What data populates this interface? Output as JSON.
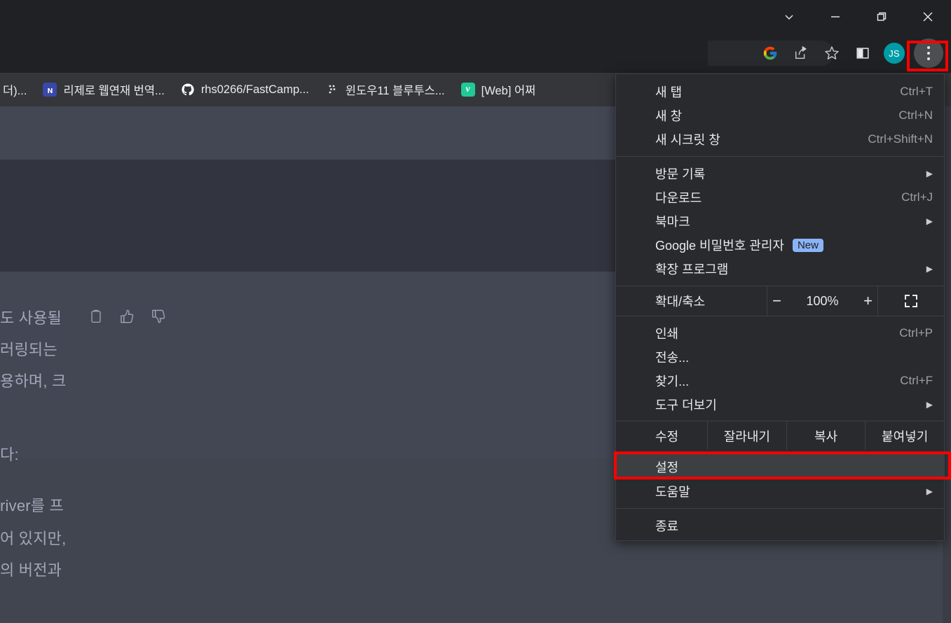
{
  "window": {
    "controls": [
      {
        "name": "chevron-down",
        "glyph": "chevron-down-icon"
      },
      {
        "name": "minimize",
        "glyph": "minimize-icon"
      },
      {
        "name": "restore",
        "glyph": "restore-icon"
      },
      {
        "name": "close",
        "glyph": "close-icon"
      }
    ]
  },
  "toolbar": {
    "icons": [
      {
        "name": "google-lens-icon",
        "label": "Google"
      },
      {
        "name": "share-icon",
        "label": "공유"
      },
      {
        "name": "bookmark-star-icon",
        "label": "북마크 추가"
      },
      {
        "name": "side-panel-icon",
        "label": "측면 패널"
      }
    ],
    "avatar_initials": "JS",
    "avatar_color": "#009ca6",
    "menu_button_label": "Chrome 맞춤설정 및 제어",
    "highlight_color": "#ff0000"
  },
  "bookmarks": [
    {
      "label": "더)...",
      "favicon": "none"
    },
    {
      "label": "리제로 웹연재 번역...",
      "favicon": "naver-blog-icon"
    },
    {
      "label": "rhs0266/FastCamp...",
      "favicon": "github-icon"
    },
    {
      "label": "윈도우11 블루투스...",
      "favicon": "braille-dots-icon"
    },
    {
      "label": "[Web] 어쩌",
      "favicon": "velog-icon"
    }
  ],
  "page": {
    "lines": [
      "도 사용될",
      "러링되는",
      "용하며, 크",
      "다:",
      "river를 프",
      "어 있지만,",
      "의 버전과"
    ],
    "action_icons": [
      {
        "name": "copy-icon"
      },
      {
        "name": "thumbs-up-icon"
      },
      {
        "name": "thumbs-down-icon"
      }
    ]
  },
  "menu": {
    "groups": [
      {
        "items": [
          {
            "label": "새 탭",
            "accel": "Ctrl+T",
            "submenu": false
          },
          {
            "label": "새 창",
            "accel": "Ctrl+N",
            "submenu": false
          },
          {
            "label": "새 시크릿 창",
            "accel": "Ctrl+Shift+N",
            "submenu": false
          }
        ]
      },
      {
        "items": [
          {
            "label": "방문 기록",
            "accel": "",
            "submenu": true
          },
          {
            "label": "다운로드",
            "accel": "Ctrl+J",
            "submenu": false
          },
          {
            "label": "북마크",
            "accel": "",
            "submenu": true
          },
          {
            "label": "Google 비밀번호 관리자",
            "accel": "",
            "submenu": false,
            "badge": "New"
          },
          {
            "label": "확장 프로그램",
            "accel": "",
            "submenu": true
          }
        ]
      }
    ],
    "zoom": {
      "label": "확대/축소",
      "minus": "−",
      "value": "100%",
      "plus": "+",
      "fullscreen_icon": "fullscreen-icon"
    },
    "group3": {
      "items": [
        {
          "label": "인쇄",
          "accel": "Ctrl+P",
          "submenu": false
        },
        {
          "label": "전송...",
          "accel": "",
          "submenu": false
        },
        {
          "label": "찾기...",
          "accel": "Ctrl+F",
          "submenu": false
        },
        {
          "label": "도구 더보기",
          "accel": "",
          "submenu": true
        }
      ]
    },
    "edit_row": {
      "label": "수정",
      "cut": "잘라내기",
      "copy": "복사",
      "paste": "붙여넣기"
    },
    "group4": {
      "items": [
        {
          "label": "설정",
          "accel": "",
          "submenu": false,
          "highlighted": true
        },
        {
          "label": "도움말",
          "accel": "",
          "submenu": true
        }
      ]
    },
    "group5": {
      "items": [
        {
          "label": "종료",
          "accel": "",
          "submenu": false
        }
      ]
    },
    "arrow_glyph": "▶"
  }
}
